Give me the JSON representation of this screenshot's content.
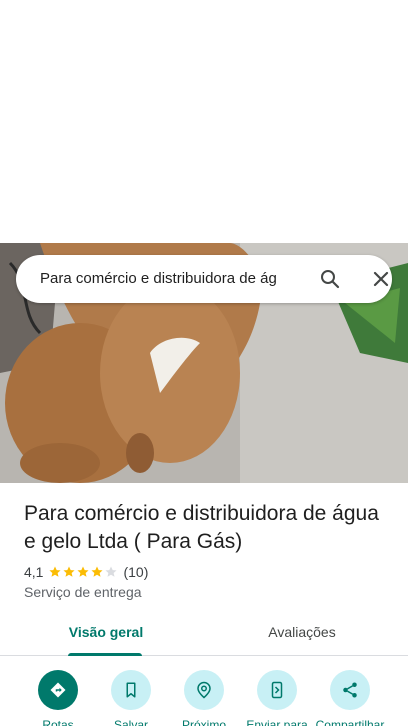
{
  "search": {
    "query": "Para comércio e distribuidora de ág"
  },
  "place": {
    "title": "Para comércio e distribuidora de água e gelo Ltda ( Para Gás)",
    "rating": "4,1",
    "stars": 4.1,
    "review_count": "(10)",
    "category": "Serviço de entrega"
  },
  "tabs": [
    {
      "label": "Visão geral",
      "active": true
    },
    {
      "label": "Avaliações",
      "active": false
    }
  ],
  "actions": [
    {
      "label": "Rotas",
      "icon": "directions-icon"
    },
    {
      "label": "Salvar",
      "icon": "bookmark-icon"
    },
    {
      "label": "Próximo",
      "icon": "nearby-icon"
    },
    {
      "label": "Enviar para",
      "icon": "send-to-phone-icon"
    },
    {
      "label": "Compartilhar",
      "icon": "share-icon"
    }
  ],
  "colors": {
    "accent": "#00796b",
    "action_bg": "#c8f0f5",
    "star": "#fbbc04"
  }
}
